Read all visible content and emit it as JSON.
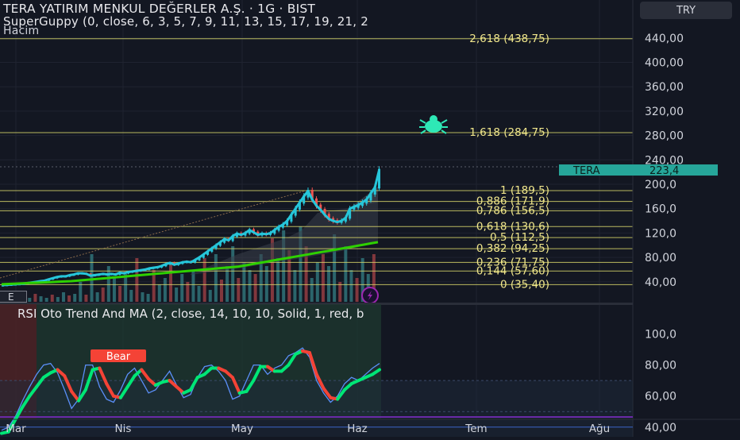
{
  "header": {
    "title": "TERA YATIRIM MENKUL DEĞERLER A.Ş. · 1G · BIST",
    "indicator": "SuperGuppy (0, close, 6, 3, 5, 7, 9, 11, 13, 15, 17, 19, 21, 2",
    "volume": "Hacim"
  },
  "currency_button": "TRY",
  "e_button": "E",
  "ticker_label": "TERA",
  "ticker_price": "223,4",
  "rsi_header": "RSI Oto Trend And MA (2, close, 14, 10, 10, Solid, 1, red, b",
  "bear_label": "Bear",
  "colors": {
    "background": "#131722",
    "fib_line": "#d8d66a",
    "candle_up": "#26c6da",
    "candle_down": "#ef5350",
    "ma_green": "#2ed100",
    "rsi_bull": "#00e676",
    "rsi_bear": "#f44336",
    "rsi_line": "#5b8ff9",
    "ticker_bg": "#26a69a",
    "bug_icon": "#2ee8b6",
    "lightning_icon": "#9c27b0"
  },
  "chart_data": [
    {
      "type": "candlestick",
      "title": "TERA YATIRIM MENKUL DEĞERLER A.Ş. · 1G · BIST",
      "x_ticks": [
        "Mar",
        "Nis",
        "May",
        "Haz",
        "Tem",
        "Ağu"
      ],
      "y_ticks": [
        "440,00",
        "400,00",
        "360,00",
        "320,00",
        "280,00",
        "240,00",
        "200,0",
        "160,0",
        "120,0",
        "80,00",
        "40,00"
      ],
      "ylim": [
        20,
        460
      ],
      "last_price": 223.4,
      "fib_levels": [
        {
          "label": "2,618 (438,75)",
          "value": 438.75
        },
        {
          "label": "1,618 (284,75)",
          "value": 284.75
        },
        {
          "label": "1 (189,5)",
          "value": 189.5
        },
        {
          "label": "0,886 (171,9)",
          "value": 171.9
        },
        {
          "label": "0,786 (156,5)",
          "value": 156.5
        },
        {
          "label": "0,618 (130,6)",
          "value": 130.6
        },
        {
          "label": "0,5 (112,5)",
          "value": 112.5
        },
        {
          "label": "0,382 (94,25)",
          "value": 94.25
        },
        {
          "label": "0,236 (71,75)",
          "value": 71.75
        },
        {
          "label": "0,144 (57,60)",
          "value": 57.6
        },
        {
          "label": "0 (35,40)",
          "value": 35.4
        }
      ],
      "price_close": [
        34.5,
        35,
        35.5,
        36,
        36.5,
        37,
        38,
        39,
        40,
        41,
        42,
        44,
        46,
        48,
        49,
        49,
        51,
        52,
        54,
        54,
        53,
        50,
        51,
        52,
        53,
        52,
        53,
        52,
        55,
        54,
        56,
        57,
        58,
        59,
        60,
        62,
        63,
        64,
        66,
        69,
        71,
        68,
        70,
        72,
        73,
        72,
        76,
        80,
        85,
        90,
        95,
        100,
        105,
        110,
        108,
        115,
        119,
        117,
        120,
        125,
        121,
        117,
        119,
        118,
        120,
        125,
        130,
        134,
        140,
        150,
        160,
        170,
        180,
        189,
        175,
        165,
        158,
        150,
        143,
        140,
        138,
        140,
        145,
        160,
        163,
        166,
        170,
        175,
        185,
        195,
        223
      ],
      "trend_ma": [
        36,
        36.5,
        37,
        37.5,
        38,
        38.5,
        39,
        39.5,
        40,
        40.5,
        41,
        42,
        43,
        44,
        45,
        46,
        47,
        48,
        49,
        50,
        51,
        52,
        53,
        54,
        55,
        56,
        57,
        58,
        59,
        60,
        61,
        62,
        63,
        64,
        65,
        67,
        69,
        71,
        73,
        75,
        77,
        79,
        81,
        83,
        85,
        87,
        89,
        91,
        93,
        95,
        97,
        99,
        101,
        103,
        105
      ]
    },
    {
      "type": "line",
      "title": "RSI Oto Trend And MA (2, close, 14, 10, 10, Solid, 1, red, b",
      "y_ticks": [
        "100,0",
        "80,00",
        "60,00",
        "40,00"
      ],
      "ylim": [
        30,
        105
      ],
      "bands": {
        "upper": 70,
        "mid": 50,
        "lower": 30
      },
      "series": [
        {
          "name": "",
          "values": [
            36,
            37,
            45,
            53,
            60,
            66,
            72,
            75,
            77,
            73,
            63,
            57,
            64,
            77,
            78,
            68,
            60,
            59,
            66,
            73,
            77,
            71,
            67,
            69,
            70,
            66,
            62,
            64,
            72,
            74,
            78,
            78,
            76,
            72,
            62,
            63,
            70,
            79,
            79,
            76,
            76,
            80,
            87,
            89,
            88,
            74,
            65,
            59,
            58,
            64,
            68,
            70,
            72,
            74,
            77
          ]
        },
        {
          "name": "",
          "values": [
            38,
            40,
            47,
            57,
            66,
            74,
            80,
            81,
            75,
            64,
            52,
            58,
            80,
            80,
            66,
            58,
            56,
            64,
            74,
            78,
            70,
            62,
            64,
            70,
            76,
            67,
            59,
            61,
            72,
            79,
            80,
            76,
            70,
            58,
            60,
            70,
            80,
            80,
            74,
            78,
            80,
            86,
            88,
            91,
            85,
            70,
            62,
            56,
            60,
            68,
            72,
            70,
            74,
            78,
            81
          ]
        }
      ]
    }
  ]
}
